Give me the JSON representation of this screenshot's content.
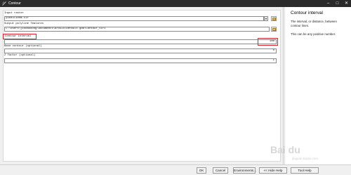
{
  "window": {
    "title": "Contour"
  },
  "form": {
    "input_raster_label": "Input raster",
    "input_raster_value": "yuchuli00m.tif",
    "output_label": "Output polyline features",
    "output_value": "C:\\Users\\jishaodong\\Documents\\ArcGIS\\Default.gdb\\Contour_tif1",
    "contour_interval_label": "Contour interval",
    "contour_interval_value": "100",
    "base_contour_label": "Base contour (optional)",
    "base_contour_value": "0",
    "z_factor_label": "Z factor (optional)",
    "z_factor_value": "1"
  },
  "help": {
    "title": "Contour interval",
    "description": "The interval, or distance, between contour lines.",
    "note": "This can be any positive number."
  },
  "buttons": {
    "ok": "OK",
    "cancel": "Cancel",
    "environments": "Environments...",
    "hide_help": "<< Hide Help",
    "tool_help": "Tool Help"
  },
  "watermark": {
    "logo": "Bai du",
    "sub": "jingyan.baidu.com"
  },
  "colors": {
    "titlebar": "#2b2b2b",
    "highlight": "#e0202c",
    "folder": "#e8c15a"
  }
}
